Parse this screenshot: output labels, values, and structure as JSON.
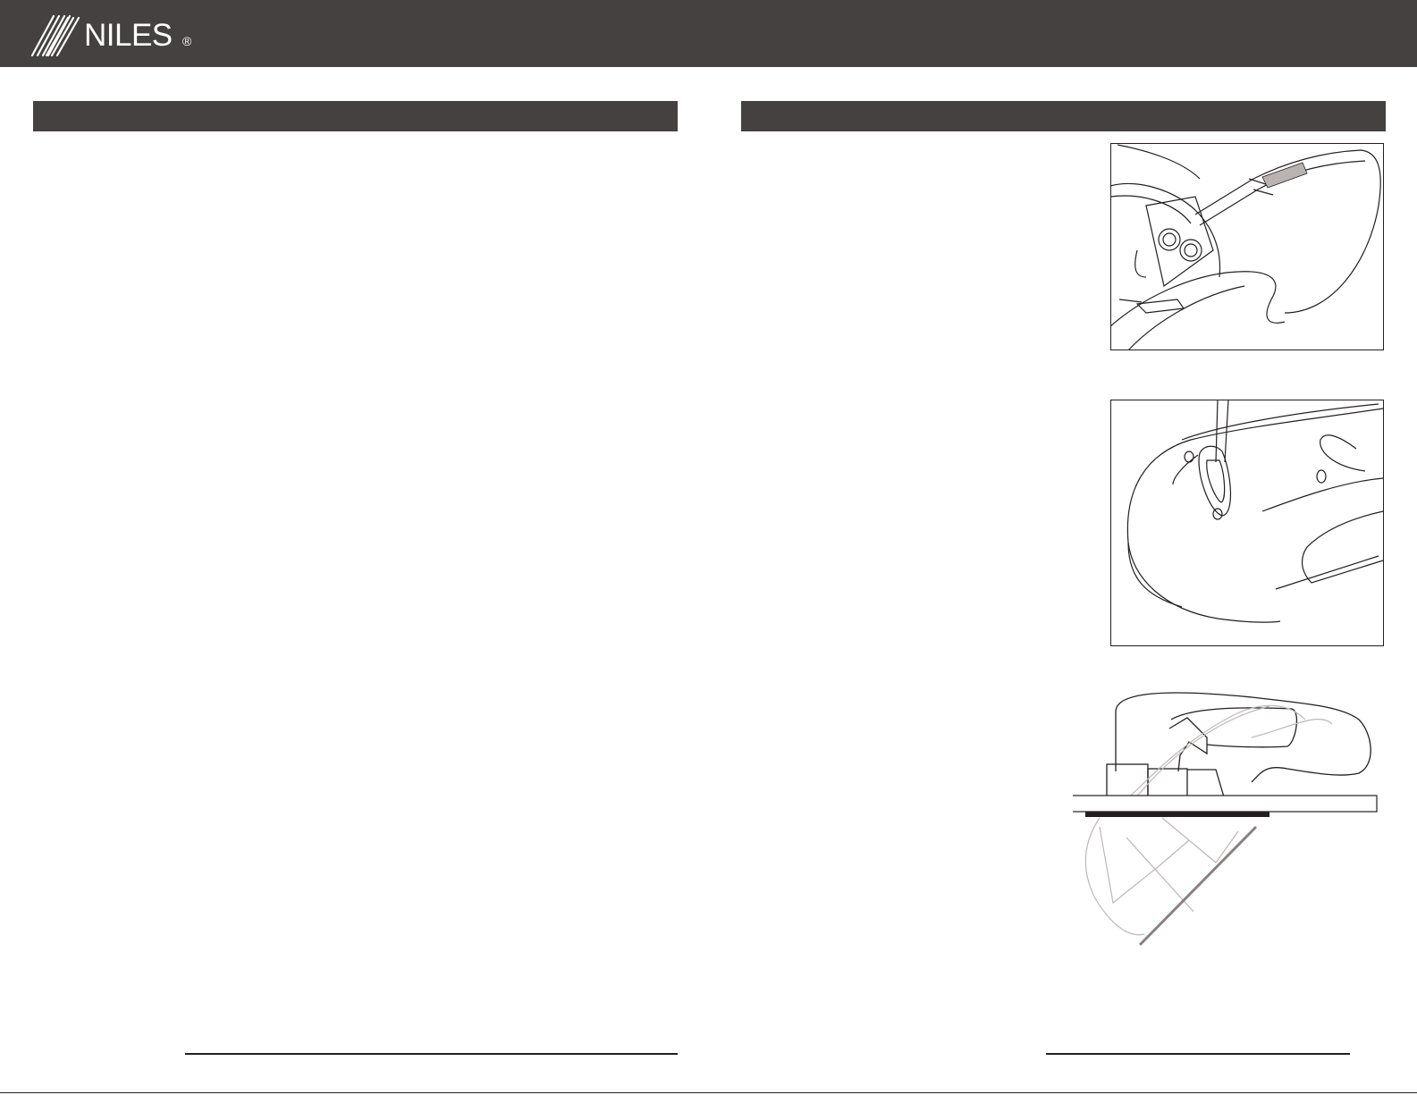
{
  "header": {
    "brand": "NILES",
    "registered_mark": "®"
  },
  "colors": {
    "header_bg": "#444140",
    "section_bar_bg": "#444140",
    "line_art": "#231f20",
    "page_bg": "#ffffff"
  },
  "icons": {
    "logo": "niles-slash-logo-icon"
  }
}
